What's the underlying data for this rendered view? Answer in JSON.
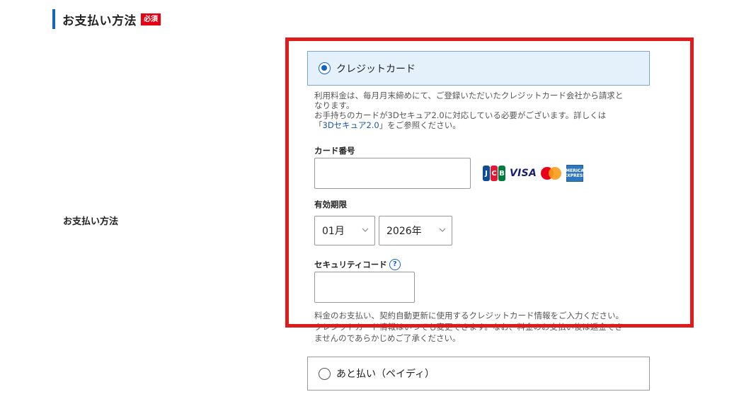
{
  "section": {
    "title": "お支払い方法",
    "required_badge": "必須"
  },
  "row_label": "お支払い方法",
  "payment_options": [
    {
      "label": "クレジットカード",
      "selected": true
    },
    {
      "label": "あと払い（ペイディ）",
      "selected": false
    }
  ],
  "notes": {
    "line1": "利用料金は、毎月月末締めにて、ご登録いただいたクレジットカード会社から請求と",
    "line2": "なります。",
    "line3": "お手持ちのカードが3Dセキュア2.0に対応している必要がございます。詳しくは",
    "link_open": "「",
    "link_text": "3Dセキュア2.0",
    "link_close": "」をご参照ください。"
  },
  "card_number": {
    "label": "カード番号",
    "value": ""
  },
  "card_brands": [
    "JCB",
    "VISA",
    "Mastercard",
    "AMERICAN EXPRESS"
  ],
  "expiry": {
    "label": "有効期限",
    "month": "01月",
    "year": "2026年"
  },
  "security_code": {
    "label": "セキュリティコード",
    "help": "?",
    "value": ""
  },
  "info_text": {
    "line1": "料金のお支払い、契約自動更新に使用するクレジットカード情報をご入力ください。",
    "line2": "クレジットカード情報はいつでも変更できます。なお、料金のお支払い後は返金でき",
    "line3": "ませんのであらかじめご了承ください。"
  },
  "colors": {
    "accent": "#1565c0",
    "highlight_frame": "#e01b1b",
    "required_badge": "#e60012",
    "selected_option_bg": "#e4f1fb"
  }
}
